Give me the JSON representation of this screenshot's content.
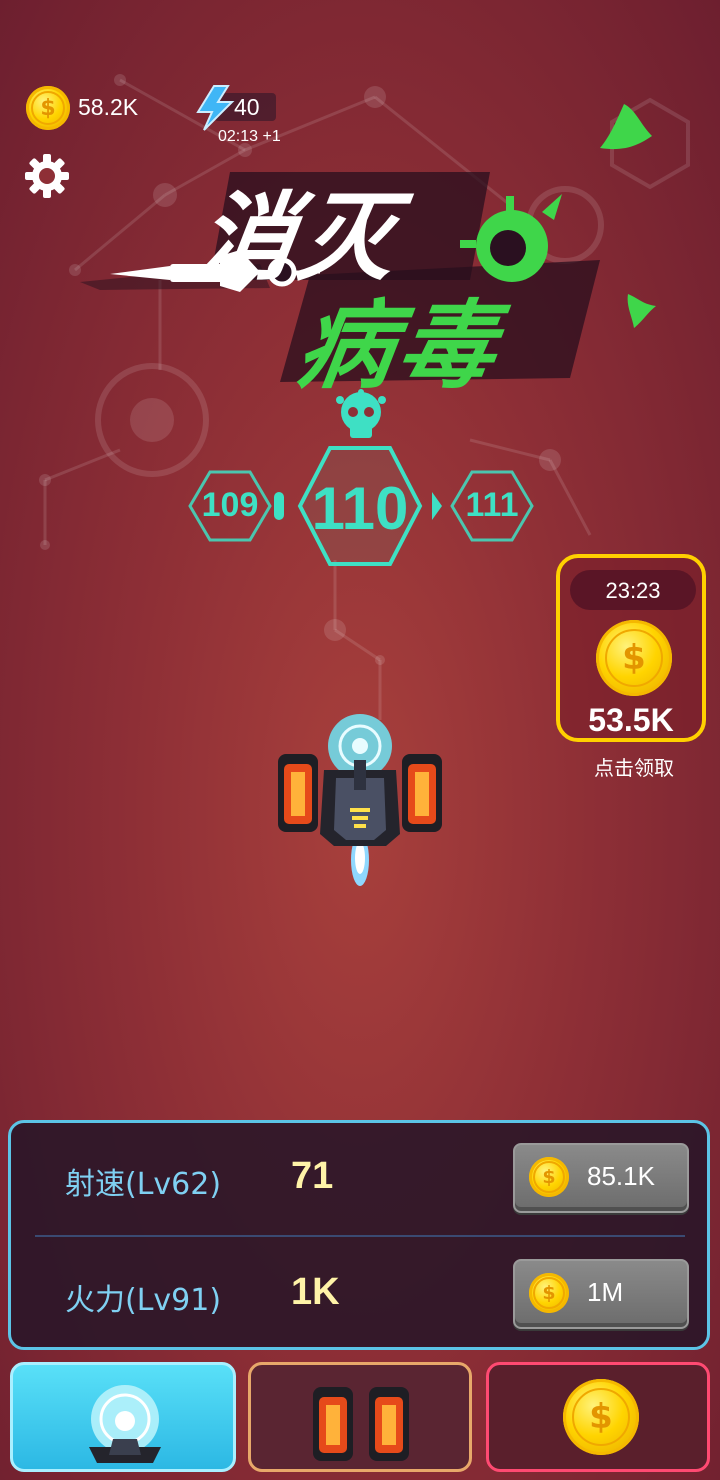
{
  "hud": {
    "coins": "58.2K",
    "energy": "40",
    "energy_timer": "02:13 +1"
  },
  "title": {
    "line1": "消灭",
    "line2": "病毒"
  },
  "levels": {
    "prev": "109",
    "current": "110",
    "next": "111"
  },
  "reward": {
    "timer": "23:23",
    "amount": "53.5K",
    "claim_label": "点击领取"
  },
  "upgrades": [
    {
      "label": "射速(Lv62)",
      "value": "71",
      "cost": "85.1K"
    },
    {
      "label": "火力(Lv91)",
      "value": "1K",
      "cost": "1M"
    }
  ],
  "colors": {
    "accent_cyan": "#5cc4e6",
    "virus_green": "#3fd64a",
    "level_teal": "#3ee0c4",
    "coin_gold": "#ffd400",
    "tab_active": "#4fd8f4",
    "tab_weapons_border": "#e8a86a",
    "tab_shop_border": "#ff4a72"
  },
  "icons": {
    "settings": "gear-icon",
    "energy": "lightning-icon",
    "coin": "coin-icon"
  }
}
